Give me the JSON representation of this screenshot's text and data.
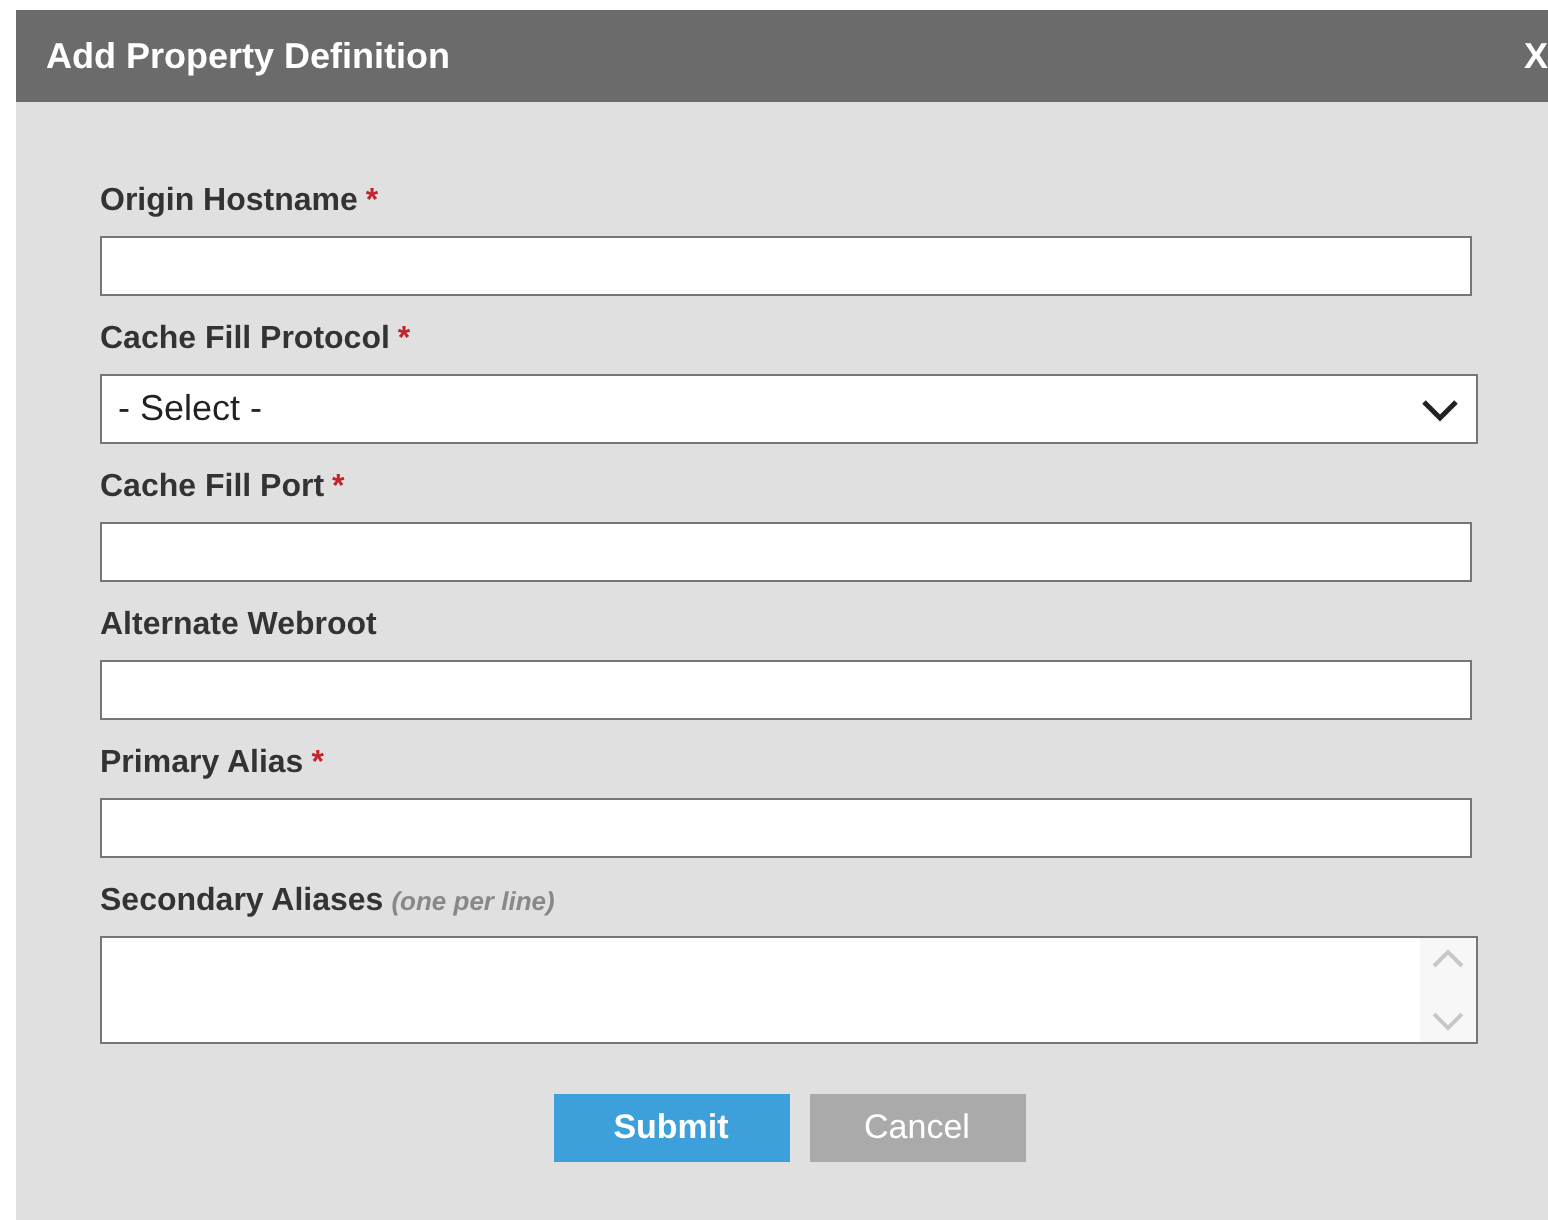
{
  "dialog": {
    "title": "Add Property Definition",
    "close": "X"
  },
  "fields": [
    {
      "kind": "text",
      "label": "Origin Hostname",
      "required_mark": "*"
    },
    {
      "kind": "select",
      "label": "Cache Fill Protocol",
      "required_mark": "*",
      "value": "- Select -"
    },
    {
      "kind": "text",
      "label": "Cache Fill Port",
      "required_mark": "*"
    },
    {
      "kind": "text",
      "label": "Alternate Webroot"
    },
    {
      "kind": "text",
      "label": "Primary Alias",
      "required_mark": "*"
    },
    {
      "kind": "textarea",
      "label": "Secondary Aliases",
      "hint": "(one per line)"
    }
  ],
  "buttons": [
    {
      "label": "Submit",
      "kind": "primary"
    },
    {
      "label": "Cancel",
      "kind": "secondary"
    }
  ]
}
